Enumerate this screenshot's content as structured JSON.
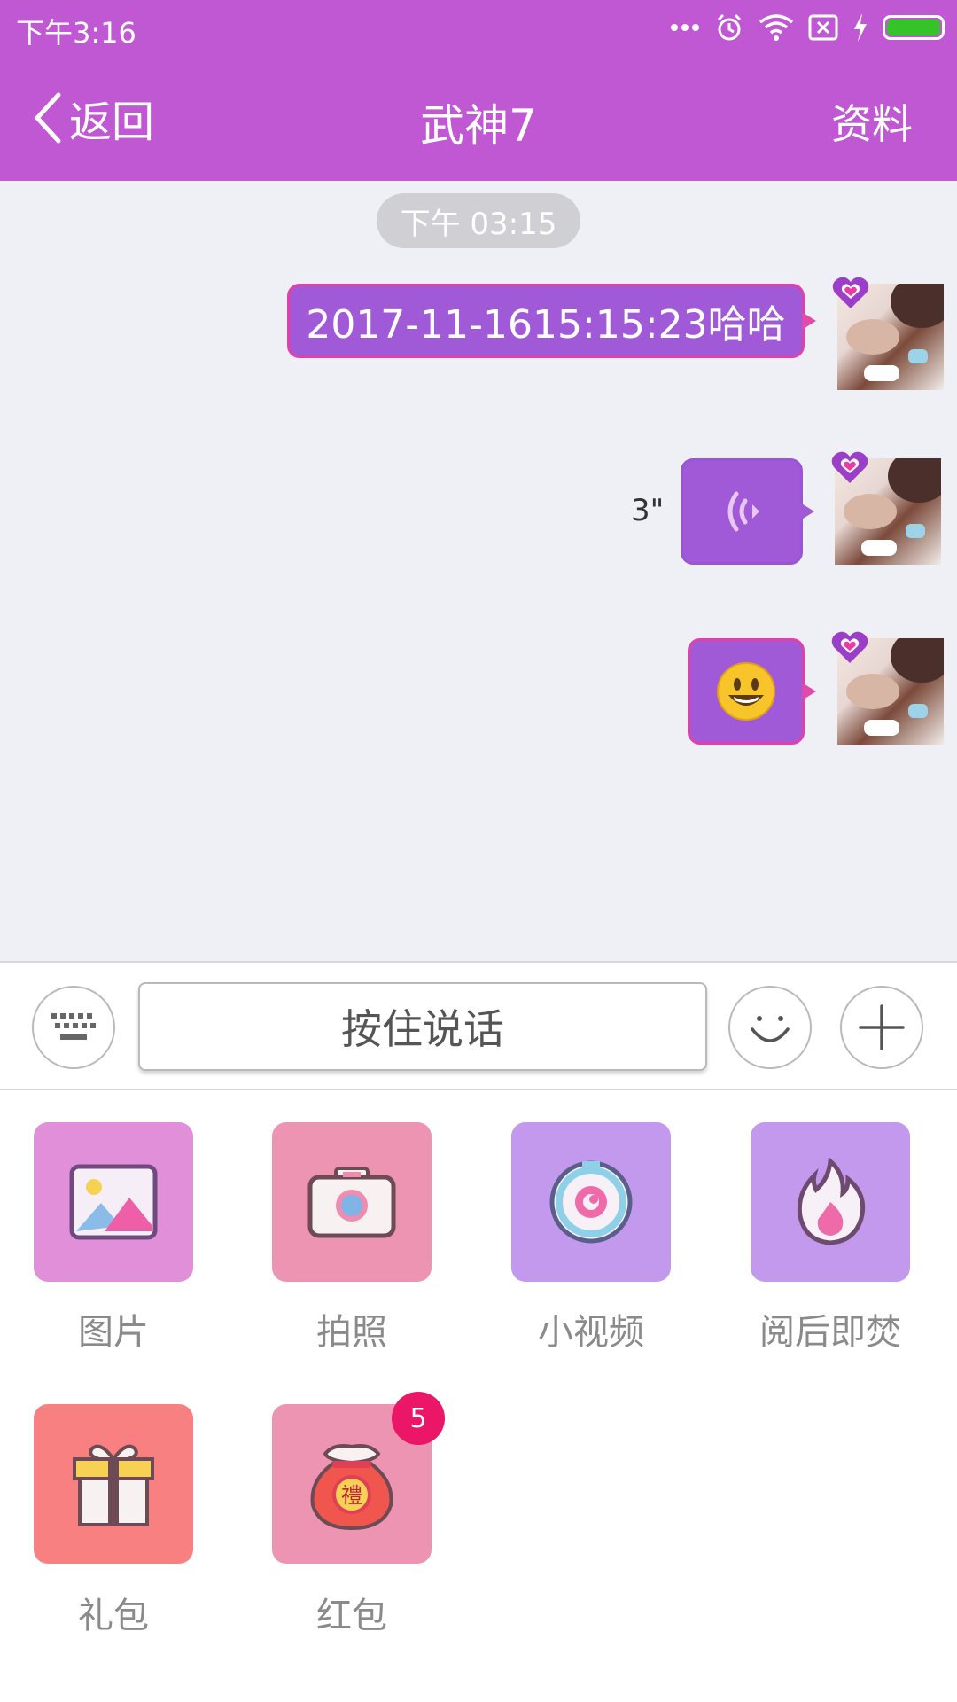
{
  "status_bar": {
    "time": "下午3:16",
    "battery_color": "#34c42a"
  },
  "header": {
    "back_label": "返回",
    "title": "武神7",
    "profile_label": "资料",
    "bg_color": "#c058d4"
  },
  "chat": {
    "timestamp": "下午 03:15",
    "messages": [
      {
        "type": "text",
        "text": "2017-11-1615:15:23哈哈"
      },
      {
        "type": "voice",
        "duration": "3\""
      },
      {
        "type": "emoji",
        "emoji": "smiley"
      }
    ]
  },
  "input_bar": {
    "hold_to_talk": "按住说话"
  },
  "tools": {
    "items": [
      {
        "label": "图片",
        "icon": "image-icon"
      },
      {
        "label": "拍照",
        "icon": "camera-icon"
      },
      {
        "label": "小视频",
        "icon": "video-icon"
      },
      {
        "label": "阅后即焚",
        "icon": "flame-icon"
      },
      {
        "label": "礼包",
        "icon": "gift-icon"
      },
      {
        "label": "红包",
        "icon": "red-envelope-icon",
        "badge": "5"
      }
    ]
  }
}
